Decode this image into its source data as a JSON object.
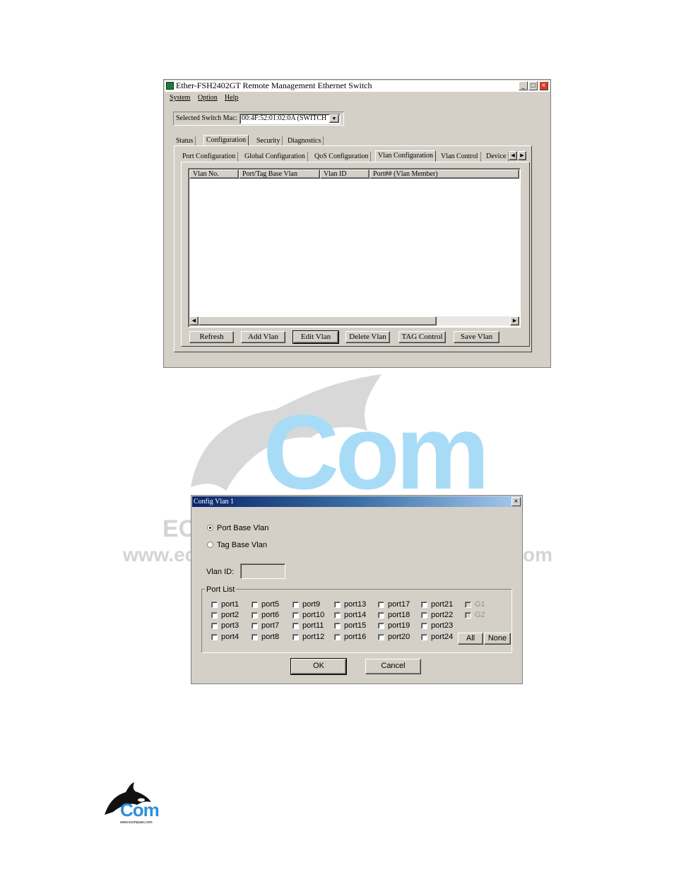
{
  "colors": {
    "face": "#d4d0c8",
    "title_active": "#0a246a",
    "watermark_blue": "#a8dcf6",
    "watermark_grey": "#d4d4d4"
  },
  "main_window": {
    "title": "Ether-FSH2402GT Remote Management Ethernet Switch",
    "menu": [
      "System",
      "Option",
      "Help"
    ],
    "switch_mac_label": "Selected Switch Mac:",
    "switch_mac_value": "00:4F:52:01:02:0A (SWITCH",
    "main_tabs": [
      "Status",
      "Configuration",
      "Security",
      "Diagnostics"
    ],
    "sub_tabs": [
      "Port Configuration",
      "Global Configuration",
      "QoS Configuration",
      "Vlan Configuration",
      "Vlan Control",
      "Device"
    ],
    "table_headers": [
      "Vlan No.",
      "Port/Tag Base Vlan",
      "Vlan ID",
      "Port## (Vlan Member)"
    ],
    "buttons": [
      "Refresh",
      "Add Vlan",
      "Edit Vlan",
      "Delete Vlan",
      "TAG Control",
      "Save Vlan"
    ]
  },
  "dialog": {
    "title": "Config Vlan 1",
    "close_symbol": "×",
    "radio_port_base": "Port Base Vlan",
    "radio_tag_base": "Tag Base Vlan",
    "vlan_id_label": "Vlan ID:",
    "vlan_id_value": "",
    "port_list_label": "Port List",
    "ports": [
      "port1",
      "port2",
      "port3",
      "port4",
      "port5",
      "port6",
      "port7",
      "port8",
      "port9",
      "port10",
      "port11",
      "port12",
      "port13",
      "port14",
      "port15",
      "port16",
      "port17",
      "port18",
      "port19",
      "port20",
      "port21",
      "port22",
      "port23",
      "port24"
    ],
    "gig_ports": [
      "G1",
      "G2"
    ],
    "all_button": "All",
    "none_button": "None",
    "ok_button": "OK",
    "cancel_button": "Cancel"
  },
  "watermark": {
    "big": "Com",
    "line1": "EC",
    "line2_left": "www.ec",
    "line2_right": "om"
  },
  "logo": {
    "text": "Com",
    "url": "www.ecompass.com"
  }
}
